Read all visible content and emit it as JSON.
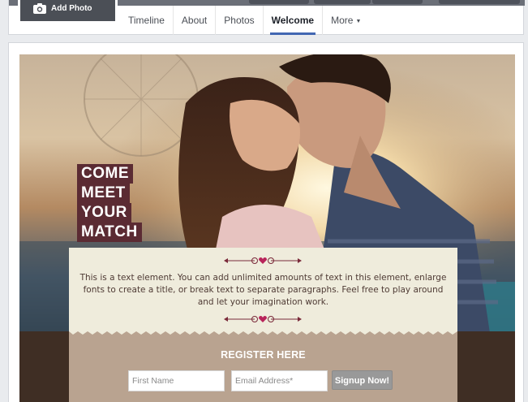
{
  "header": {
    "add_photo_label": "Add Photo",
    "tabs": [
      {
        "label": "Timeline",
        "active": false
      },
      {
        "label": "About",
        "active": false
      },
      {
        "label": "Photos",
        "active": false
      },
      {
        "label": "Welcome",
        "active": true
      },
      {
        "label": "More",
        "active": false,
        "has_dropdown": true
      }
    ],
    "accent_color": "#4267b2"
  },
  "hero": {
    "headline_lines": [
      "COME",
      "MEET",
      "YOUR",
      "MATCH"
    ],
    "headline_bg_color": "#5b2b33",
    "body_text": "This is a text element. You can add unlimited amounts of text in this element, enlarge fonts to create a title, or break text to separate paragraphs. Feel free to play around and let your imagination work."
  },
  "register": {
    "title": "REGISTER HERE",
    "first_name_placeholder": "First Name",
    "email_placeholder": "Email Address*",
    "signup_label": "Signup Now!"
  }
}
